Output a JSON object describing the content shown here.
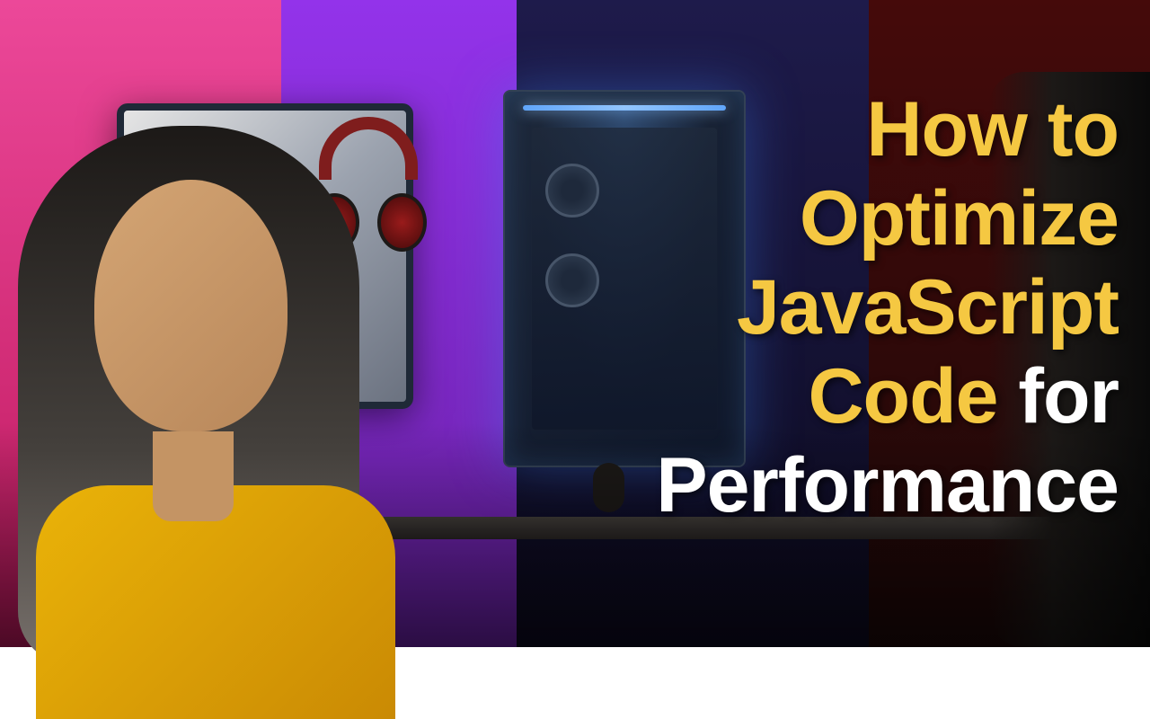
{
  "title": {
    "line1": "How to",
    "line2": "Optimize",
    "line3": "JavaScript",
    "line4_part1": "Code",
    "line4_part2": "for",
    "line5": "Performance"
  },
  "colors": {
    "accent_yellow": "#f5c842",
    "accent_white": "#ffffff"
  }
}
